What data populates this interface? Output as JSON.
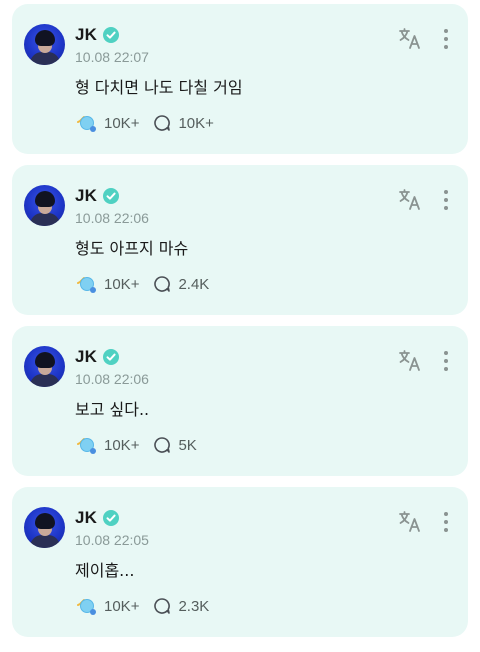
{
  "colors": {
    "card_background": "#e8f8f5",
    "verified_badge": "#4fd1c2",
    "reaction_accent": "#f0b940",
    "reaction_bubble": "#58b7e8"
  },
  "posts": [
    {
      "author": "JK",
      "time": "10.08 22:07",
      "text": "형 다치면 나도 다칠 거임",
      "reactions": "10K+",
      "comments": "10K+"
    },
    {
      "author": "JK",
      "time": "10.08 22:06",
      "text": "형도 아프지 마슈",
      "reactions": "10K+",
      "comments": "2.4K"
    },
    {
      "author": "JK",
      "time": "10.08 22:06",
      "text": "보고 싶다..",
      "reactions": "10K+",
      "comments": "5K"
    },
    {
      "author": "JK",
      "time": "10.08 22:05",
      "text": "제이홉...",
      "reactions": "10K+",
      "comments": "2.3K"
    }
  ],
  "icons": {
    "verified": "verified-badge-icon",
    "translate": "translate-icon",
    "more": "more-options-icon",
    "reaction": "reaction-icon",
    "comment": "comment-icon"
  }
}
